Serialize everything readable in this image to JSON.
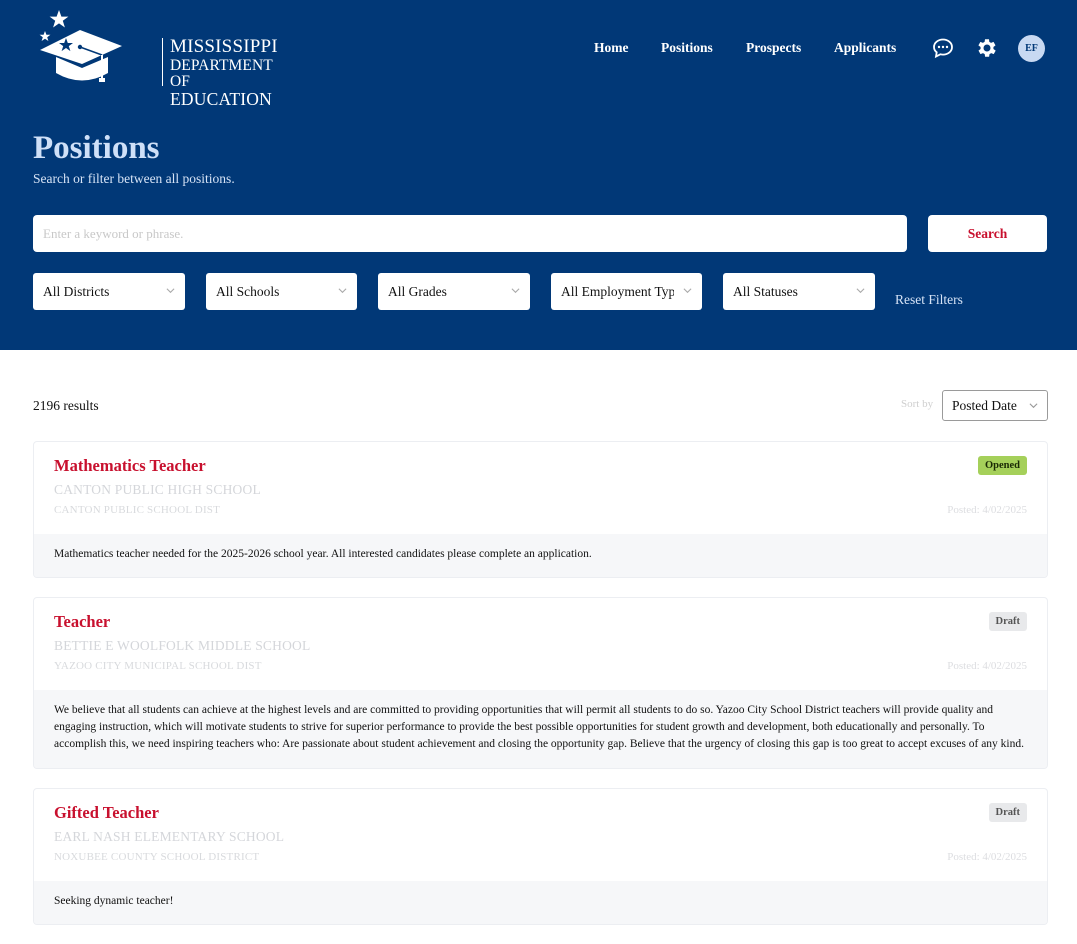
{
  "header": {
    "logo": {
      "line1": "MISSISSIPPI",
      "line2": "DEPARTMENT OF",
      "line3": "EDUCATION"
    },
    "nav": [
      {
        "label": "Home"
      },
      {
        "label": "Positions"
      },
      {
        "label": "Prospects"
      },
      {
        "label": "Applicants"
      }
    ],
    "icons": {
      "messages": "chat-bubble-icon",
      "settings": "gear-icon"
    },
    "avatar_initials": "EF"
  },
  "hero": {
    "title": "Positions",
    "subtitle": "Search or filter between all positions.",
    "search_placeholder": "Enter a keyword or phrase.",
    "search_value": "",
    "search_button": "Search",
    "filters": [
      {
        "label": "All Districts"
      },
      {
        "label": "All Schools"
      },
      {
        "label": "All Grades"
      },
      {
        "label": "All Employment Types"
      },
      {
        "label": "All Statuses"
      }
    ],
    "reset_label": "Reset Filters"
  },
  "results": {
    "count_text": "2196 results",
    "sort_label": "Sort by",
    "sort_value": "Posted Date"
  },
  "positions": [
    {
      "title": "Mathematics Teacher",
      "school": "CANTON PUBLIC HIGH SCHOOL",
      "district": "CANTON PUBLIC SCHOOL DIST",
      "posted": "Posted: 4/02/2025",
      "status": "Opened",
      "description": "Mathematics teacher needed for the 2025-2026 school year. All interested candidates please complete an application."
    },
    {
      "title": "Teacher",
      "school": "BETTIE E WOOLFOLK MIDDLE SCHOOL",
      "district": "YAZOO CITY MUNICIPAL SCHOOL DIST",
      "posted": "Posted: 4/02/2025",
      "status": "Draft",
      "description": "We believe that all students can achieve at the highest levels and are committed to providing opportunities that will permit all students to do so. Yazoo City School District teachers will provide quality and engaging instruction, which will motivate students to strive for superior performance to provide the best possible opportunities for student growth and development, both educationally and personally. To accomplish this, we need inspiring teachers who: Are passionate about student achievement and closing the opportunity gap. Believe that the urgency of closing this gap is too great to accept excuses of any kind."
    },
    {
      "title": "Gifted Teacher",
      "school": "EARL NASH ELEMENTARY SCHOOL",
      "district": "NOXUBEE COUNTY SCHOOL DISTRICT",
      "posted": "Posted: 4/02/2025",
      "status": "Draft",
      "description": "Seeking dynamic teacher!"
    }
  ],
  "colors": {
    "hero_bg": "#013877",
    "accent_red": "#c8102e",
    "opened_badge": "#a5d05a",
    "draft_badge": "#e8e9eb"
  }
}
